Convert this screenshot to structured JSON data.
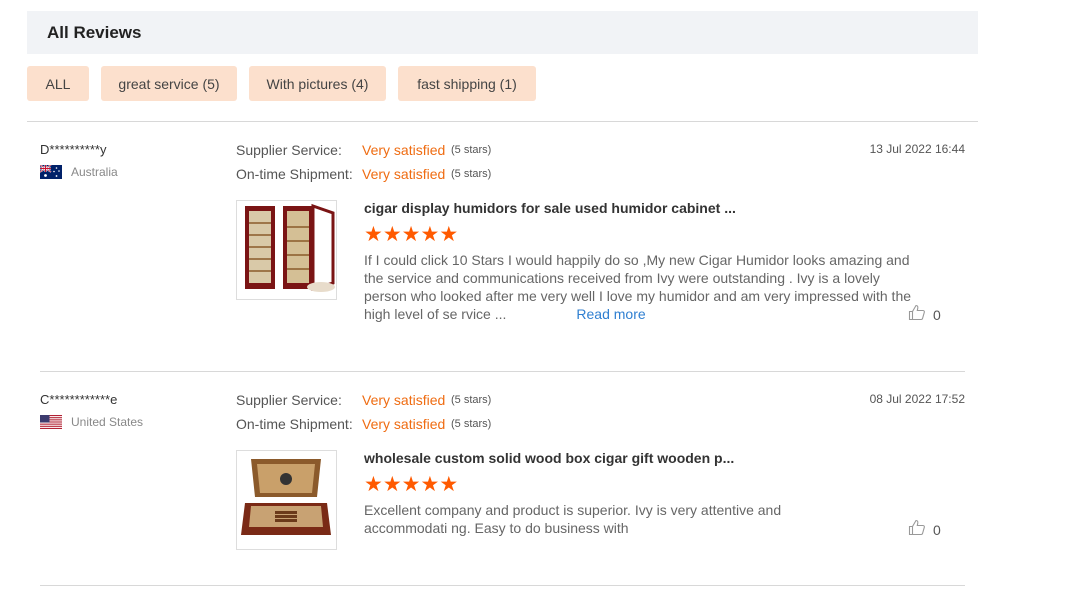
{
  "header": {
    "title": "All Reviews"
  },
  "filters": [
    {
      "label": "ALL"
    },
    {
      "label": "great service (5)"
    },
    {
      "label": "With pictures (4)"
    },
    {
      "label": "fast shipping (1)"
    }
  ],
  "rating_labels": {
    "supplier": "Supplier Service:",
    "shipment": "On-time Shipment:"
  },
  "reviews": [
    {
      "user": "D**********y",
      "country": "Australia",
      "flag_icon": "australia-flag-icon",
      "supplier_rating": "Very satisfied",
      "supplier_stars": "(5 stars)",
      "shipment_rating": "Very satisfied",
      "shipment_stars": "(5 stars)",
      "date": "13 Jul 2022 16:44",
      "product_title": "cigar display humidors for sale used humidor cabinet ...",
      "stars": 5,
      "text": "If I could click 10 Stars I would happily do so ,My new Cigar Humidor looks amazing and the service and communications received from Ivy were outstanding . Ivy is a lovely person who looked after me very well I love my humidor and am very impressed with the high level of se rvice ...",
      "read_more": "Read more",
      "likes": "0"
    },
    {
      "user": "C************e",
      "country": "United States",
      "flag_icon": "usa-flag-icon",
      "supplier_rating": "Very satisfied",
      "supplier_stars": "(5 stars)",
      "shipment_rating": "Very satisfied",
      "shipment_stars": "(5 stars)",
      "date": "08 Jul 2022 17:52",
      "product_title": "wholesale custom solid wood box cigar gift wooden p...",
      "stars": 5,
      "text": "Excellent company and product is superior. Ivy is very attentive and accommodati ng.  Easy to do business with",
      "likes": "0"
    }
  ],
  "colors": {
    "accent_orange": "#ef6c12",
    "star_orange": "#ff5a00",
    "link_blue": "#2f7fd1",
    "filter_bg": "#fce0cd",
    "header_bg": "#f1f3f6"
  }
}
